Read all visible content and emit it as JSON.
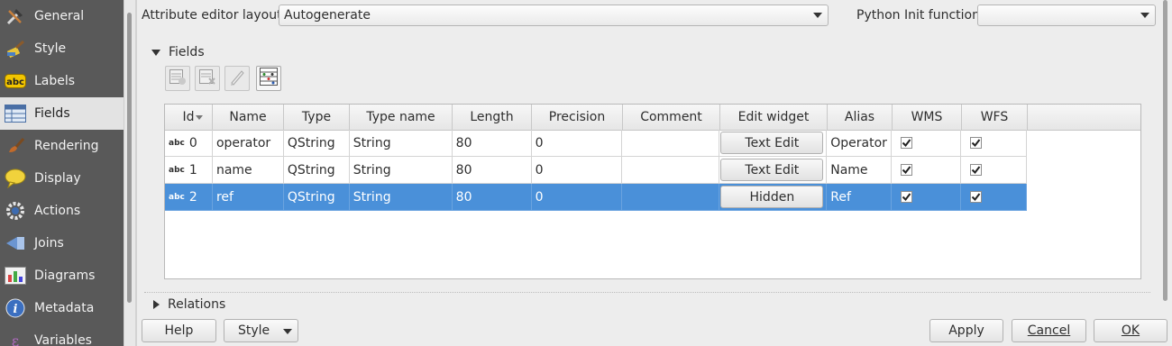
{
  "sidebar": {
    "items": [
      {
        "label": "General",
        "icon": "general-tools-icon"
      },
      {
        "label": "Style",
        "icon": "style-brush-icon"
      },
      {
        "label": "Labels",
        "icon": "labels-abc-icon"
      },
      {
        "label": "Fields",
        "icon": "fields-table-icon",
        "selected": true
      },
      {
        "label": "Rendering",
        "icon": "rendering-brush-icon"
      },
      {
        "label": "Display",
        "icon": "display-bubble-icon"
      },
      {
        "label": "Actions",
        "icon": "actions-gear-icon"
      },
      {
        "label": "Joins",
        "icon": "joins-icon"
      },
      {
        "label": "Diagrams",
        "icon": "diagrams-icon"
      },
      {
        "label": "Metadata",
        "icon": "metadata-info-icon"
      },
      {
        "label": "Variables",
        "icon": "variables-icon"
      }
    ]
  },
  "top": {
    "layout_label": "Attribute editor layout:",
    "layout_value": "Autogenerate",
    "python_label": "Python Init function",
    "python_value": ""
  },
  "fields_group": {
    "title": "Fields",
    "columns": [
      "Id",
      "Name",
      "Type",
      "Type name",
      "Length",
      "Precision",
      "Comment",
      "Edit widget",
      "Alias",
      "WMS",
      "WFS"
    ],
    "rows": [
      {
        "type_icon": "abc",
        "id": "0",
        "name": "operator",
        "type": "QString",
        "type_name": "String",
        "length": "80",
        "precision": "0",
        "comment": "",
        "edit_widget": "Text Edit",
        "alias": "Operator",
        "wms": true,
        "wfs": true
      },
      {
        "type_icon": "abc",
        "id": "1",
        "name": "name",
        "type": "QString",
        "type_name": "String",
        "length": "80",
        "precision": "0",
        "comment": "",
        "edit_widget": "Text Edit",
        "alias": "Name",
        "wms": true,
        "wfs": true
      },
      {
        "type_icon": "abc",
        "id": "2",
        "name": "ref",
        "type": "QString",
        "type_name": "String",
        "length": "80",
        "precision": "0",
        "comment": "",
        "edit_widget": "Hidden",
        "alias": "Ref",
        "wms": true,
        "wfs": true,
        "selected": true
      }
    ]
  },
  "relations_group": {
    "title": "Relations"
  },
  "buttons": {
    "help": "Help",
    "style": "Style",
    "apply": "Apply",
    "cancel": "Cancel",
    "ok": "OK"
  },
  "colors": {
    "selection": "#4a90d9",
    "sidebar_bg": "#595959"
  }
}
